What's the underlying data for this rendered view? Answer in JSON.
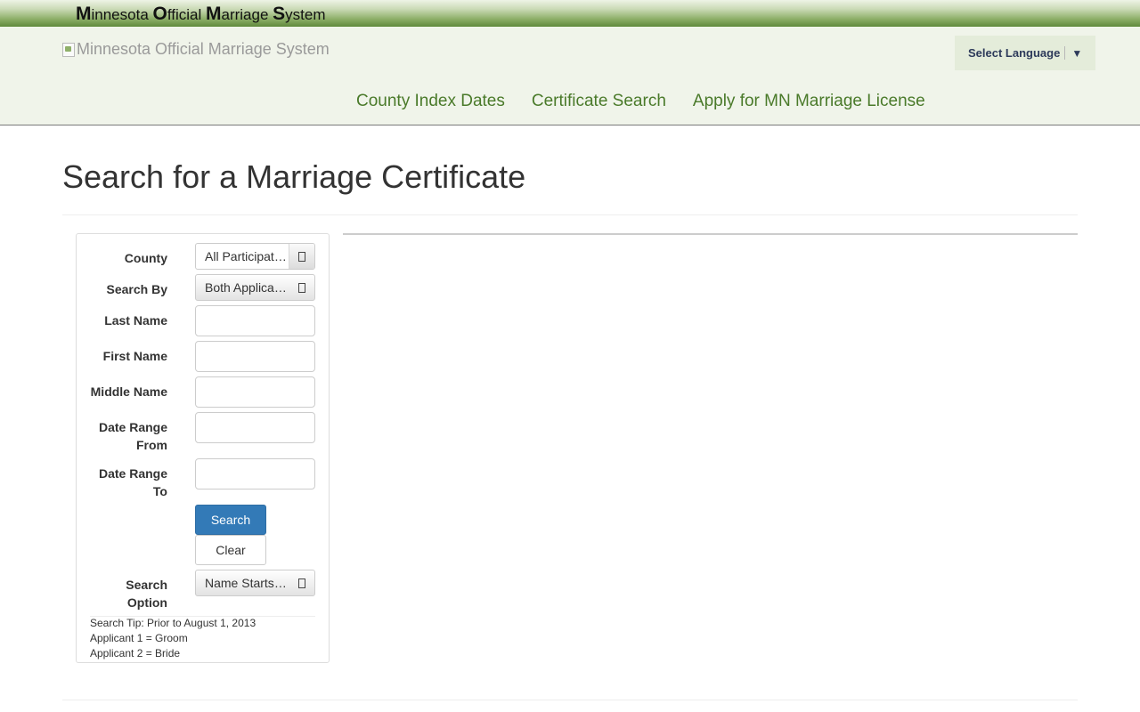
{
  "topbar": {
    "title_parts": [
      {
        "cap": "M",
        "rest": "innesota "
      },
      {
        "cap": "O",
        "rest": "fficial "
      },
      {
        "cap": "M",
        "rest": "arriage "
      },
      {
        "cap": "S",
        "rest": "ystem"
      }
    ]
  },
  "header": {
    "logo_alt": "Minnesota Official Marriage System",
    "language": {
      "label": "Select Language",
      "arrow": "▼"
    }
  },
  "nav": {
    "items": [
      "County Index Dates",
      "Certificate Search",
      "Apply for MN Marriage License"
    ]
  },
  "page": {
    "title": "Search for a Marriage Certificate"
  },
  "form": {
    "county": {
      "label": "County",
      "value": "All Participating Counties"
    },
    "search_by": {
      "label": "Search By",
      "value": "Both Applicants"
    },
    "last_name": {
      "label": "Last Name",
      "value": ""
    },
    "first_name": {
      "label": "First Name",
      "value": ""
    },
    "middle_name": {
      "label": "Middle Name",
      "value": ""
    },
    "date_from": {
      "label_line1": "Date Range",
      "label_line2": "From",
      "value": ""
    },
    "date_to": {
      "label_line1": "Date Range",
      "label_line2": "To",
      "value": ""
    },
    "search_button": "Search",
    "clear_button": "Clear",
    "search_option": {
      "label_line1": "Search",
      "label_line2": "Option",
      "value": "Name Starts With"
    },
    "tip": {
      "line1": "Search Tip: Prior to August 1, 2013",
      "line2": "Applicant 1 = Groom",
      "line3": "Applicant 2 = Bride"
    }
  }
}
